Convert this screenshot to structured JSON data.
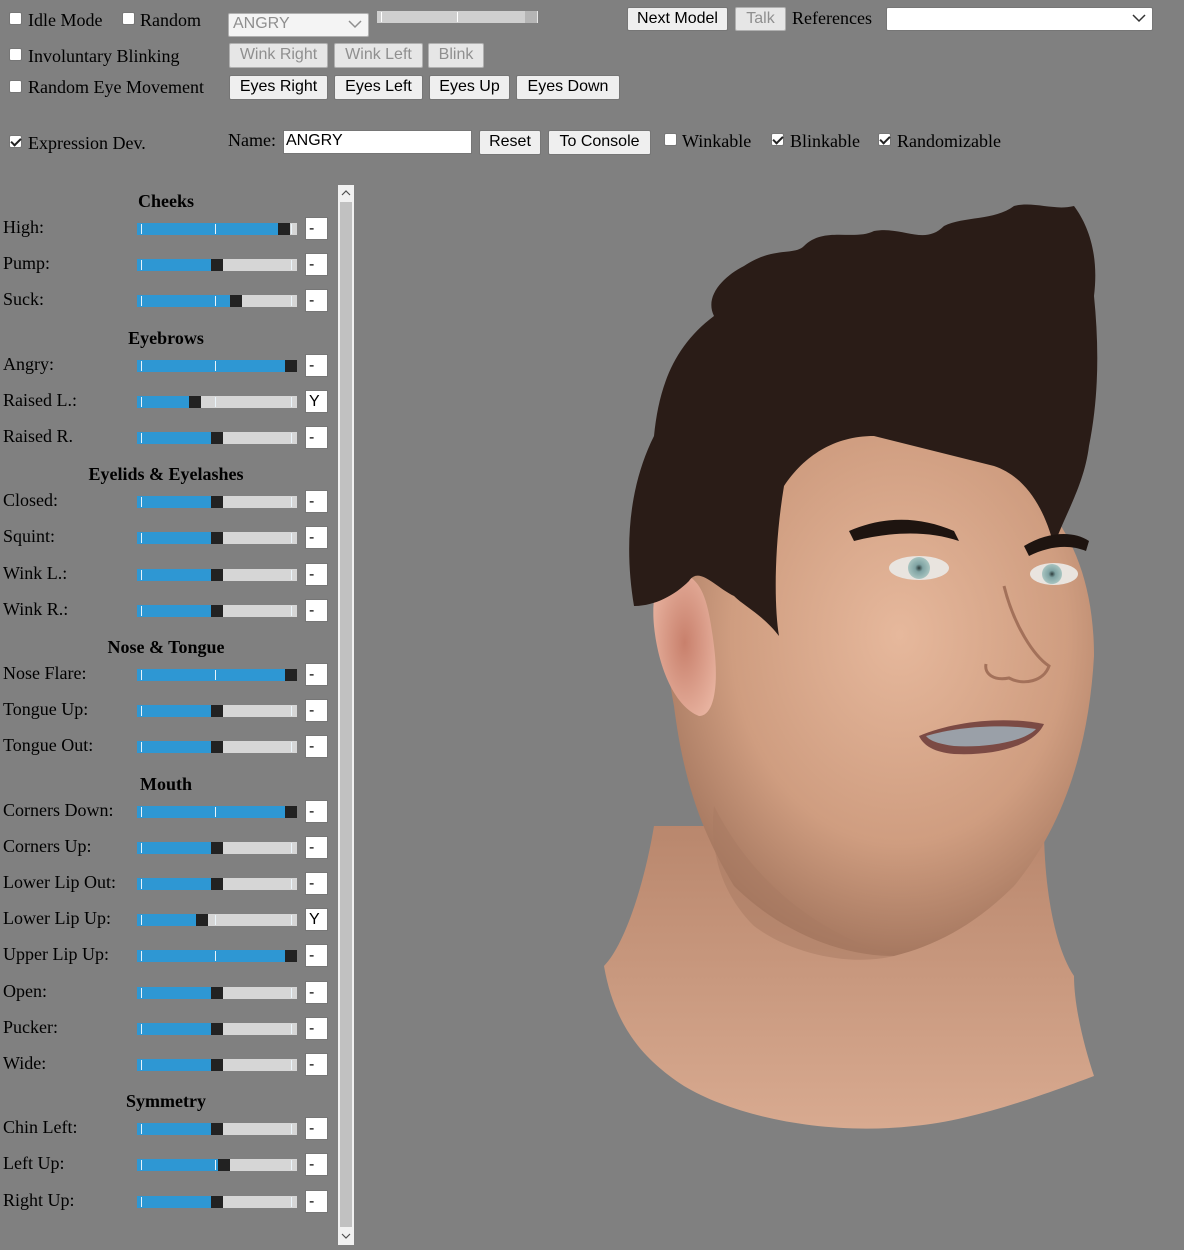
{
  "controls": {
    "idle_mode": {
      "label": "Idle Mode",
      "checked": false
    },
    "random": {
      "label": "Random",
      "checked": false
    },
    "expression_select": "ANGRY",
    "next_model": "Next Model",
    "talk": "Talk",
    "references_label": "References",
    "references_value": "",
    "involuntary_blinking": {
      "label": "Involuntary Blinking",
      "checked": false
    },
    "wink_right": "Wink Right",
    "wink_left": "Wink Left",
    "blink": "Blink",
    "random_eye_movement": {
      "label": "Random Eye Movement",
      "checked": false
    },
    "eyes_right": "Eyes Right",
    "eyes_left": "Eyes Left",
    "eyes_up": "Eyes Up",
    "eyes_down": "Eyes Down",
    "expression_dev": {
      "label": "Expression Dev.",
      "checked": true
    },
    "name_label": "Name:",
    "name_value": "ANGRY",
    "reset": "Reset",
    "to_console": "To Console",
    "winkable": {
      "label": "Winkable",
      "checked": false
    },
    "blinkable": {
      "label": "Blinkable",
      "checked": true
    },
    "randomizable": {
      "label": "Randomizable",
      "checked": true
    }
  },
  "sections": [
    {
      "title": "Cheeks",
      "rows": [
        {
          "label": "High:",
          "value": 0.95,
          "flag": "-"
        },
        {
          "label": "Pump:",
          "value": 0.5,
          "flag": "-"
        },
        {
          "label": "Suck:",
          "value": 0.63,
          "flag": "-"
        }
      ]
    },
    {
      "title": "Eyebrows",
      "rows": [
        {
          "label": "Angry:",
          "value": 1.0,
          "flag": "-"
        },
        {
          "label": "Raised L.:",
          "value": 0.35,
          "flag": "Y"
        },
        {
          "label": "Raised R.",
          "value": 0.5,
          "flag": "-"
        }
      ]
    },
    {
      "title": "Eyelids & Eyelashes",
      "rows": [
        {
          "label": "Closed:",
          "value": 0.5,
          "flag": "-"
        },
        {
          "label": "Squint:",
          "value": 0.5,
          "flag": "-"
        },
        {
          "label": "Wink L.:",
          "value": 0.5,
          "flag": "-"
        },
        {
          "label": "Wink R.:",
          "value": 0.5,
          "flag": "-"
        }
      ]
    },
    {
      "title": "Nose & Tongue",
      "rows": [
        {
          "label": "Nose Flare:",
          "value": 1.0,
          "flag": "-"
        },
        {
          "label": "Tongue Up:",
          "value": 0.5,
          "flag": "-"
        },
        {
          "label": "Tongue Out:",
          "value": 0.5,
          "flag": "-"
        }
      ]
    },
    {
      "title": "Mouth",
      "rows": [
        {
          "label": "Corners Down:",
          "value": 1.0,
          "flag": "-"
        },
        {
          "label": "Corners Up:",
          "value": 0.5,
          "flag": "-"
        },
        {
          "label": "Lower Lip Out:",
          "value": 0.5,
          "flag": "-"
        },
        {
          "label": "Lower Lip Up:",
          "value": 0.4,
          "flag": "Y"
        },
        {
          "label": "Upper Lip Up:",
          "value": 1.0,
          "flag": "-"
        },
        {
          "label": "Open:",
          "value": 0.5,
          "flag": "-"
        },
        {
          "label": "Pucker:",
          "value": 0.5,
          "flag": "-"
        },
        {
          "label": "Wide:",
          "value": 0.5,
          "flag": "-"
        }
      ]
    },
    {
      "title": "Symmetry",
      "rows": [
        {
          "label": "Chin Left:",
          "value": 0.5,
          "flag": "-"
        },
        {
          "label": "Left Up:",
          "value": 0.55,
          "flag": "-"
        },
        {
          "label": "Right Up:",
          "value": 0.5,
          "flag": "-"
        }
      ]
    }
  ],
  "colors": {
    "background": "#808080",
    "slider_fill": "#2e97d3",
    "slider_track": "#d6d6d6",
    "slider_thumb": "#222222",
    "hair": "#2a1c17",
    "skin": "#d9a98c"
  }
}
